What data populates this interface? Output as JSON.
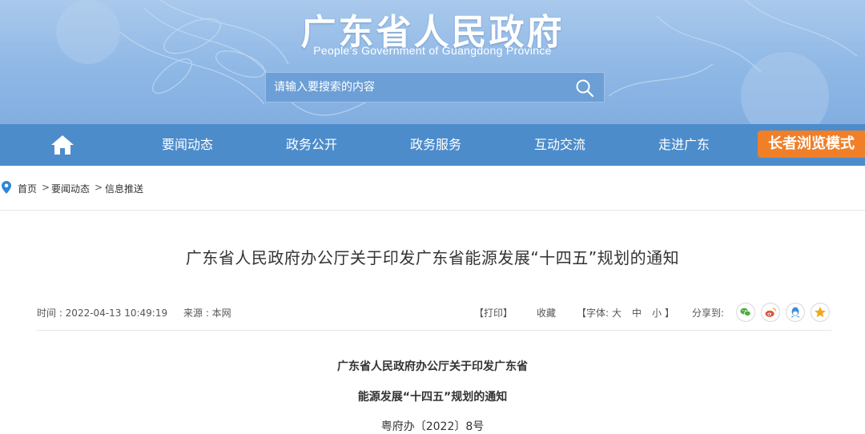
{
  "header": {
    "title": "广东省人民政府",
    "subtitle": "People's Government of Guangdong Province",
    "search_placeholder": "请输入要搜索的内容"
  },
  "nav": {
    "items": [
      "要闻动态",
      "政务公开",
      "政务服务",
      "互动交流",
      "走进广东"
    ],
    "elder_mode": "长者浏览模式"
  },
  "breadcrumb": {
    "items": [
      "首页",
      "要闻动态",
      "信息推送"
    ],
    "separator": ">"
  },
  "article": {
    "title": "广东省人民政府办公厅关于印发广东省能源发展“十四五”规划的通知",
    "time": "时间 : 2022-04-13 10:49:19",
    "source": "来源 : 本网",
    "print_label": "【打印】",
    "favorite_label": "收藏",
    "font_label": "【字体:",
    "font_large": "大",
    "font_medium": "中",
    "font_small": "小",
    "font_close": "】",
    "share_label": "分享到:",
    "body_title_line1": "广东省人民政府办公厅关于印发广东省",
    "body_title_line2": "能源发展“十四五”规划的通知",
    "doc_number": "粤府办〔2022〕8号"
  },
  "colors": {
    "nav_bg": "#4d8ccb",
    "elder_mode_bg": "#f07f28",
    "wechat": "#4cae3b",
    "weibo": "#e2513a",
    "qq": "#3a8fd8",
    "qzone": "#f2a81d"
  },
  "icons": {
    "home": "home-icon",
    "search": "search-icon",
    "location": "location-pin-icon",
    "wechat": "wechat-icon",
    "weibo": "weibo-icon",
    "qq": "qq-icon",
    "qzone": "qzone-star-icon"
  }
}
